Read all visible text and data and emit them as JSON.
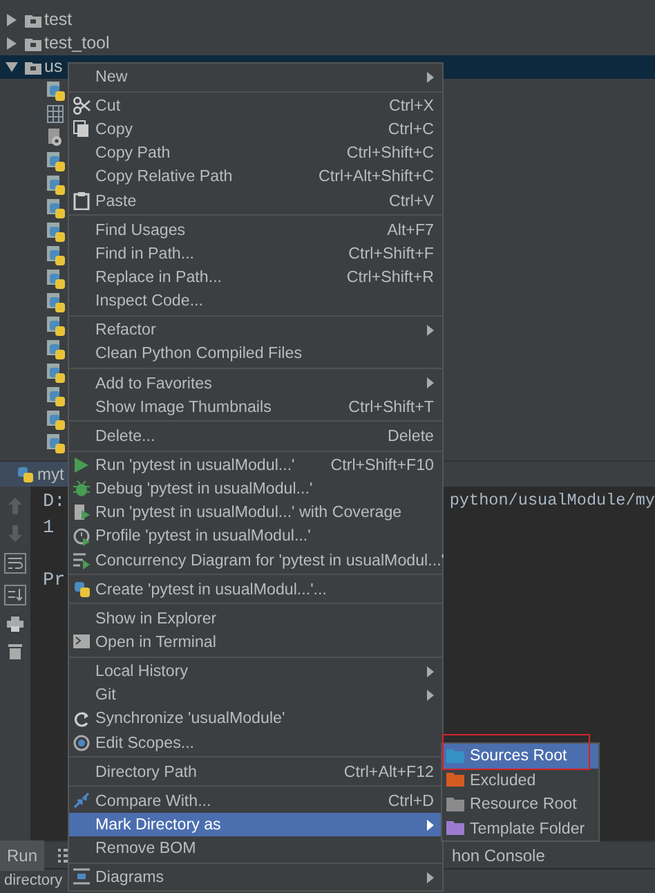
{
  "project_tree": {
    "rows": [
      {
        "label": "test",
        "expanded": false,
        "selected": false
      },
      {
        "label": "test_tool",
        "expanded": false,
        "selected": false
      },
      {
        "label": "us",
        "expanded": true,
        "selected": true
      }
    ]
  },
  "run_panel": {
    "tab": {
      "label": "myt",
      "selected": true
    },
    "console": [
      {
        "text": "D:",
        "tail": "python/usualModule/my",
        "gap_before": false
      },
      {
        "text": "1",
        "gap_before": false
      },
      {
        "text": "Pr",
        "gap_before": true
      }
    ]
  },
  "bottom_bar": {
    "tabs": [
      {
        "label": "Run",
        "selected": true
      },
      {
        "label": "hon Console",
        "selected": false
      }
    ]
  },
  "status_bar": {
    "text": "directory"
  },
  "context_menu": {
    "groups": [
      [
        {
          "label": "New",
          "submenu": true,
          "selected": false
        }
      ],
      [
        {
          "label": "Cut",
          "shortcut": "Ctrl+X",
          "submenu": false,
          "selected": false
        },
        {
          "label": "Copy",
          "shortcut": "Ctrl+C",
          "submenu": false,
          "selected": false
        },
        {
          "label": "Copy Path",
          "shortcut": "Ctrl+Shift+C",
          "submenu": false,
          "selected": false
        },
        {
          "label": "Copy Relative Path",
          "shortcut": "Ctrl+Alt+Shift+C",
          "submenu": false,
          "selected": false
        },
        {
          "label": "Paste",
          "shortcut": "Ctrl+V",
          "submenu": false,
          "selected": false
        }
      ],
      [
        {
          "label": "Find Usages",
          "shortcut": "Alt+F7",
          "submenu": false,
          "selected": false
        },
        {
          "label": "Find in Path...",
          "shortcut": "Ctrl+Shift+F",
          "submenu": false,
          "selected": false
        },
        {
          "label": "Replace in Path...",
          "shortcut": "Ctrl+Shift+R",
          "submenu": false,
          "selected": false
        },
        {
          "label": "Inspect Code...",
          "submenu": false,
          "selected": false
        }
      ],
      [
        {
          "label": "Refactor",
          "submenu": true,
          "selected": false
        },
        {
          "label": "Clean Python Compiled Files",
          "submenu": false,
          "selected": false
        }
      ],
      [
        {
          "label": "Add to Favorites",
          "submenu": true,
          "selected": false
        },
        {
          "label": "Show Image Thumbnails",
          "shortcut": "Ctrl+Shift+T",
          "submenu": false,
          "selected": false
        }
      ],
      [
        {
          "label": "Delete...",
          "shortcut": "Delete",
          "submenu": false,
          "selected": false
        }
      ],
      [
        {
          "label": "Run 'pytest in usualModul...'",
          "shortcut": "Ctrl+Shift+F10",
          "submenu": false,
          "selected": false
        },
        {
          "label": "Debug 'pytest in usualModul...'",
          "submenu": false,
          "selected": false
        },
        {
          "label": "Run 'pytest in usualModul...' with Coverage",
          "submenu": false,
          "selected": false
        },
        {
          "label": "Profile 'pytest in usualModul...'",
          "submenu": false,
          "selected": false
        },
        {
          "label": "Concurrency Diagram for 'pytest in usualModul...'",
          "submenu": false,
          "selected": false
        }
      ],
      [
        {
          "label": "Create 'pytest in usualModul...'...",
          "submenu": false,
          "selected": false
        }
      ],
      [
        {
          "label": "Show in Explorer",
          "submenu": false,
          "selected": false
        },
        {
          "label": "Open in Terminal",
          "submenu": false,
          "selected": false
        }
      ],
      [
        {
          "label": "Local History",
          "submenu": true,
          "selected": false
        },
        {
          "label": "Git",
          "submenu": true,
          "selected": false
        },
        {
          "label": "Synchronize 'usualModule'",
          "submenu": false,
          "selected": false
        },
        {
          "label": "Edit Scopes...",
          "submenu": false,
          "selected": false
        }
      ],
      [
        {
          "label": "Directory Path",
          "shortcut": "Ctrl+Alt+F12",
          "submenu": false,
          "selected": false
        }
      ],
      [
        {
          "label": "Compare With...",
          "shortcut": "Ctrl+D",
          "submenu": false,
          "selected": false
        },
        {
          "label": "Mark Directory as",
          "submenu": true,
          "selected": true
        },
        {
          "label": "Remove BOM",
          "submenu": false,
          "selected": false
        }
      ],
      [
        {
          "label": "Diagrams",
          "submenu": true,
          "selected": false
        }
      ]
    ]
  },
  "submenu": {
    "items": [
      {
        "label": "Sources Root",
        "color": "#3592c4",
        "selected": true,
        "annotated": true
      },
      {
        "label": "Excluded",
        "color": "#d35b20",
        "selected": false,
        "annotated": false
      },
      {
        "label": "Resource Root",
        "color": "#8a8a8a",
        "selected": false,
        "annotated": false
      },
      {
        "label": "Template Folder",
        "color": "#9b7bd0",
        "selected": false,
        "annotated": false
      }
    ]
  }
}
